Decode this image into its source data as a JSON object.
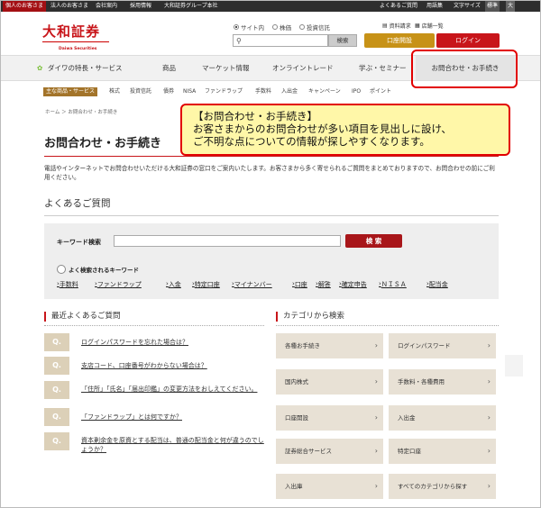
{
  "topbar": {
    "left": [
      "個人のお客さま",
      "法人のお客さま",
      "会社案内",
      "採用情報",
      "大和証券グループ本社"
    ],
    "right": [
      "よくあるご質問",
      "用語集",
      "文字サイズ",
      "標準",
      "大"
    ]
  },
  "logo": {
    "main": "大和証券",
    "sub": "Daiwa Securities"
  },
  "search": {
    "radios": [
      "サイト内",
      "株価",
      "投資信託"
    ],
    "button": "検索"
  },
  "utility": {
    "material": "資料請求",
    "shops": "店舗一覧"
  },
  "header_buttons": {
    "open": "口座開設",
    "login": "ログイン"
  },
  "gnav": [
    "ダイワの特長・サービス",
    "商品",
    "マーケット情報",
    "オンライントレード",
    "学ぶ・セミナー",
    "お問合わせ・お手続き"
  ],
  "subnav": {
    "tag": "主な商品・サービス",
    "items": [
      "株式",
      "投資信託",
      "債券",
      "NISA",
      "ファンドラップ",
      "手数料",
      "入出金",
      "キャンペーン",
      "IPO",
      "ポイント"
    ]
  },
  "breadcrumb": "ホーム ＞ お問合わせ・お手続き",
  "callout": {
    "line1": "【お問合わせ・お手続き】",
    "line2": "お客さまからのお問合わせが多い項目を見出しに設け、",
    "line3": "ご不明な点についての情報が探しやすくなります。"
  },
  "page_title": "お問合わせ・お手続き",
  "intro": "電話やインターネットでお問合わせいただける大和証券の窓口をご案内いたします。お客さまから多く寄せられるご質問をまとめておりますので、お問合わせの前にご利用ください。",
  "faq_section": {
    "title": "よくあるご質問",
    "keyword_label": "キーワード検索",
    "search_button": "検 索",
    "frequent_label": "よく検索されるキーワード",
    "keywords": [
      "手数料",
      "ファンドラップ",
      "入金",
      "特定口座",
      "マイナンバー",
      "口座",
      "解答",
      "確定申告",
      "ＮＩＳＡ",
      "配当金"
    ]
  },
  "recent": {
    "title": "最近よくあるご質問",
    "items": [
      "ログインパスワードを忘れた場合は？",
      "支店コード、口座番号がわからない場合は？",
      "「住所」「氏名」「届出印鑑」の変更方法をおしえてください。",
      "「ファンドラップ」とは何ですか？",
      "資本剰余金を原資とする配当は、普通の配当金と何が違うのでしょうか？"
    ],
    "q_mark": "Q."
  },
  "categories": {
    "title": "カテゴリから検索",
    "items": [
      "各種お手続き",
      "ログインパスワード",
      "国内株式",
      "手数料・各種費用",
      "口座開設",
      "入出金",
      "証券総合サービス",
      "特定口座",
      "入出庫",
      "すべてのカテゴリから探す"
    ],
    "chevron": "›"
  }
}
